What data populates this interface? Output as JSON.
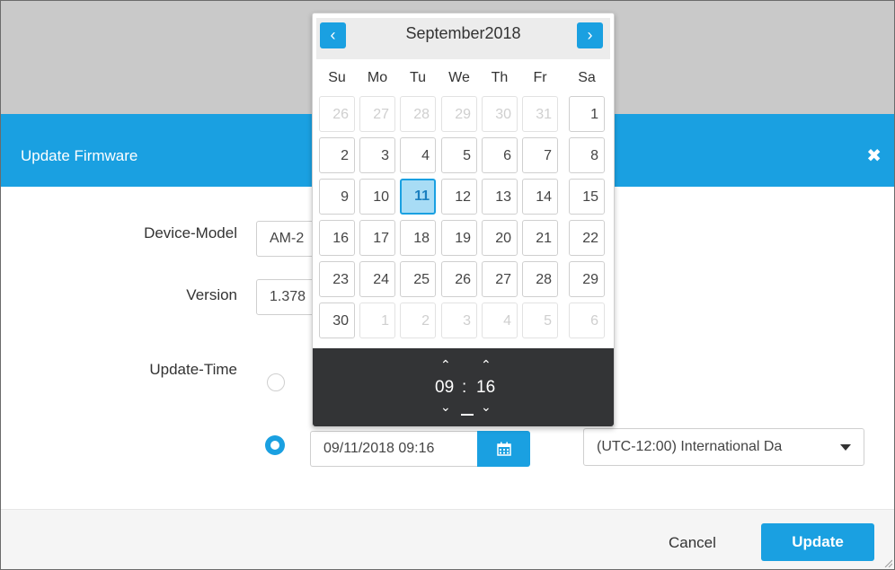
{
  "dialog": {
    "title": "Update Firmware",
    "close_icon": "close-icon"
  },
  "form": {
    "device_model_label": "Device-Model",
    "device_model_value": "AM-2",
    "version_label": "Version",
    "version_value": "1.378",
    "update_time_label": "Update-Time",
    "datetime_value": "09/11/2018 09:16",
    "timezone_value": "(UTC-12:00) International Da"
  },
  "calendar": {
    "month": "September",
    "year": "2018",
    "weekdays": [
      "Su",
      "Mo",
      "Tu",
      "We",
      "Th",
      "Fr",
      "Sa"
    ],
    "weeks": [
      [
        "26",
        "27",
        "28",
        "29",
        "30",
        "31",
        "1"
      ],
      [
        "2",
        "3",
        "4",
        "5",
        "6",
        "7",
        "8"
      ],
      [
        "9",
        "10",
        "11",
        "12",
        "13",
        "14",
        "15"
      ],
      [
        "16",
        "17",
        "18",
        "19",
        "20",
        "21",
        "22"
      ],
      [
        "23",
        "24",
        "25",
        "26",
        "27",
        "28",
        "29"
      ],
      [
        "30",
        "1",
        "2",
        "3",
        "4",
        "5",
        "6"
      ]
    ],
    "selected_day": "11",
    "prev_icon": "chevron-left-icon",
    "next_icon": "chevron-right-icon"
  },
  "time": {
    "hour": "09",
    "separator": ":",
    "minute": "16"
  },
  "footer": {
    "cancel_label": "Cancel",
    "update_label": "Update"
  },
  "colors": {
    "accent": "#1aa0e1",
    "selected_day_bg": "#a8dcf5",
    "time_bar_bg": "#333436",
    "overlay_gray": "#c9c9c9"
  }
}
